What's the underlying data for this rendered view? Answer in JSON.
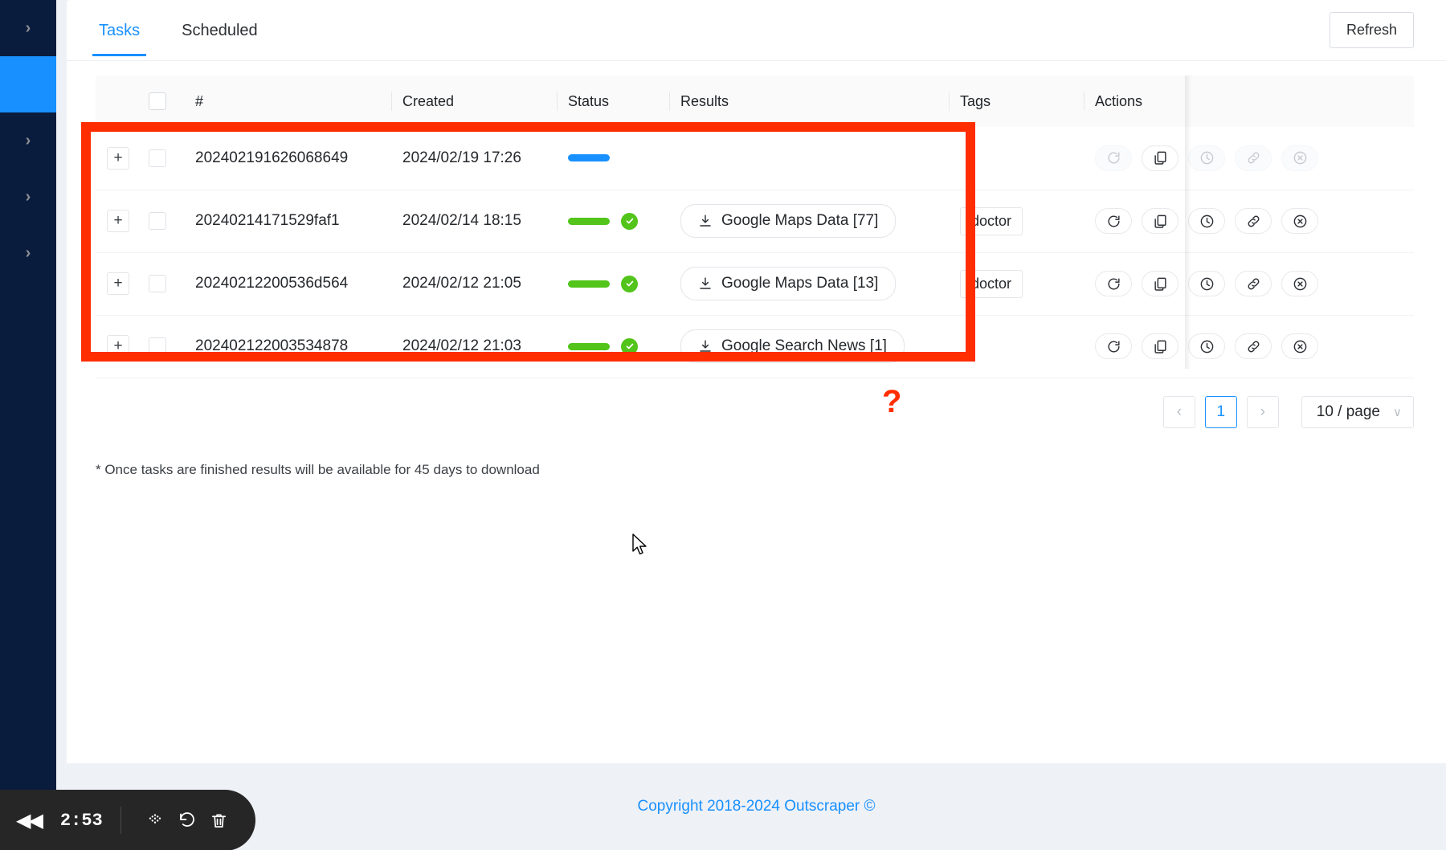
{
  "sidebar": {
    "items": [
      {
        "name": "nav-item-1",
        "icon": "chevron-right-icon",
        "active": false
      },
      {
        "name": "nav-item-2",
        "icon": "",
        "active": true
      },
      {
        "name": "nav-item-3",
        "icon": "chevron-right-icon",
        "active": false
      },
      {
        "name": "nav-item-4",
        "icon": "chevron-right-icon",
        "active": false
      },
      {
        "name": "nav-item-5",
        "icon": "chevron-right-icon",
        "active": false
      }
    ],
    "chevron": "›"
  },
  "tabs": [
    {
      "label": "Tasks",
      "active": true
    },
    {
      "label": "Scheduled",
      "active": false
    }
  ],
  "toolbar": {
    "refresh_label": "Refresh"
  },
  "table": {
    "columns": [
      "",
      "",
      "#",
      "Created",
      "Status",
      "Results",
      "Tags",
      "Actions"
    ],
    "expand_label": "+",
    "rows": [
      {
        "id": "202402191626068649",
        "created": "2024/02/19 17:26",
        "status": "running",
        "status_color": "#1890ff",
        "results": "",
        "results_count": "",
        "tag": "",
        "actions_disabled": true
      },
      {
        "id": "20240214171529faf1",
        "created": "2024/02/14 18:15",
        "status": "done",
        "status_color": "#52c41a",
        "results": "Google Maps Data [77]",
        "tag": "doctor",
        "actions_disabled": false
      },
      {
        "id": "20240212200536d564",
        "created": "2024/02/12 21:05",
        "status": "done",
        "status_color": "#52c41a",
        "results": "Google Maps Data [13]",
        "tag": "doctor",
        "actions_disabled": false
      },
      {
        "id": "202402122003534878",
        "created": "2024/02/12 21:03",
        "status": "done",
        "status_color": "#52c41a",
        "results": "Google Search News [1]",
        "tag": "",
        "actions_disabled": false
      }
    ],
    "action_icons": [
      "rerun-icon",
      "copy-icon",
      "schedule-clock-icon",
      "link-icon",
      "cancel-x-icon"
    ]
  },
  "pagination": {
    "prev": "‹",
    "next": "›",
    "current_page": "1",
    "page_size": "10 / page",
    "chevron": "∨"
  },
  "note": "* Once tasks are finished results will be available for 45 days to download",
  "annotation": {
    "question_mark": "?",
    "highlight_color": "#ff2d00"
  },
  "footer": {
    "copyright": "Copyright 2018-2024 Outscraper ©",
    "link_color": "#1890ff"
  },
  "recorder": {
    "rewind": "◀◀",
    "time": "2:53",
    "icons": [
      "dots-grid-icon",
      "undo-icon",
      "trash-icon"
    ]
  }
}
